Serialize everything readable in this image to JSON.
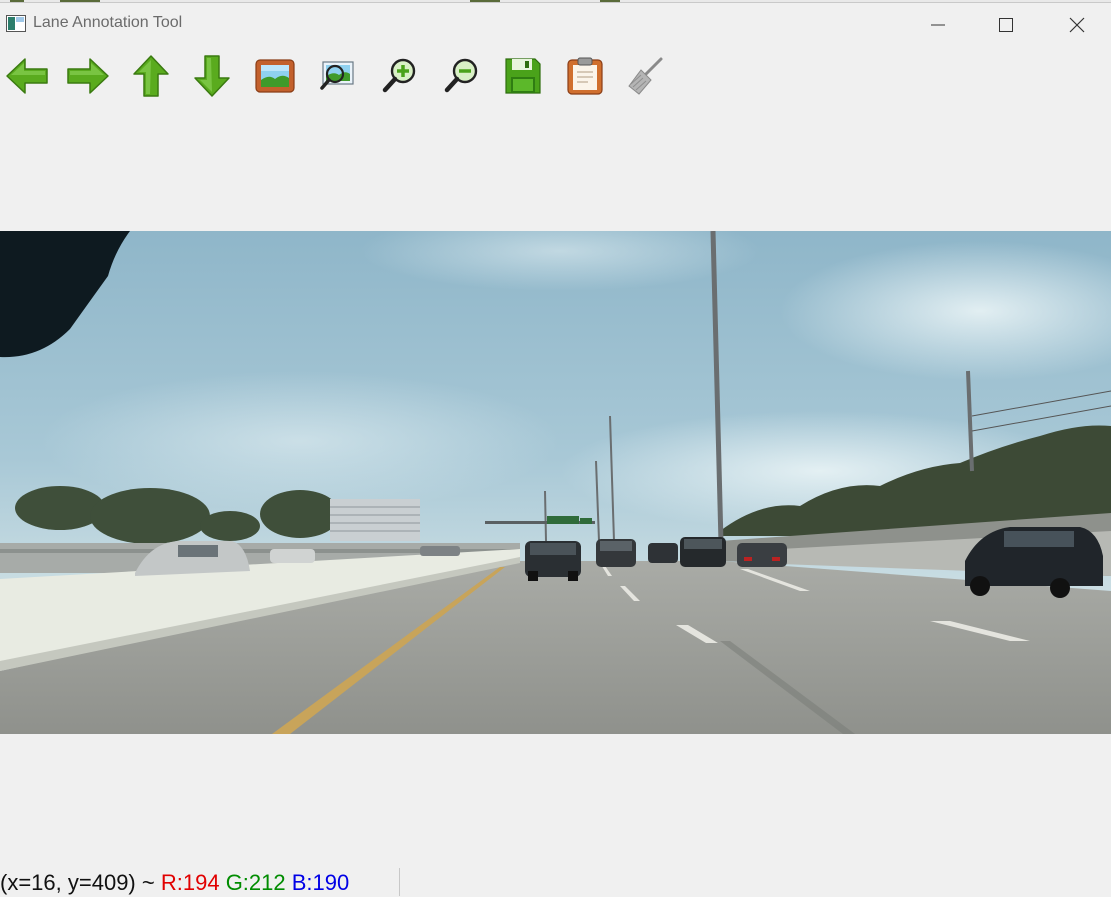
{
  "window": {
    "title": "Lane Annotation Tool",
    "controls": {
      "minimize": "minimize-icon",
      "maximize": "maximize-icon",
      "close": "close-icon"
    }
  },
  "toolbar": {
    "buttons": [
      {
        "name": "previous",
        "icon": "arrow-left-icon"
      },
      {
        "name": "next",
        "icon": "arrow-right-icon"
      },
      {
        "name": "up",
        "icon": "arrow-up-icon"
      },
      {
        "name": "down",
        "icon": "arrow-down-icon"
      },
      {
        "name": "open-image",
        "icon": "image-icon"
      },
      {
        "name": "fit-zoom",
        "icon": "zoom-fit-icon"
      },
      {
        "name": "zoom-in",
        "icon": "zoom-in-icon"
      },
      {
        "name": "zoom-out",
        "icon": "zoom-out-icon"
      },
      {
        "name": "save",
        "icon": "floppy-disk-icon"
      },
      {
        "name": "clipboard",
        "icon": "clipboard-icon"
      },
      {
        "name": "clear",
        "icon": "broom-icon"
      }
    ],
    "colors": {
      "arrow": "#58a81c",
      "image_frame": "#c05a28",
      "disabled": "#9a9a9a"
    }
  },
  "status": {
    "coords": "(x=16, y=409) ~",
    "r": "R:194",
    "g": "G:212",
    "b": "B:190",
    "colors": {
      "r": "#e10000",
      "g": "#008c00",
      "b": "#0000e6"
    }
  }
}
